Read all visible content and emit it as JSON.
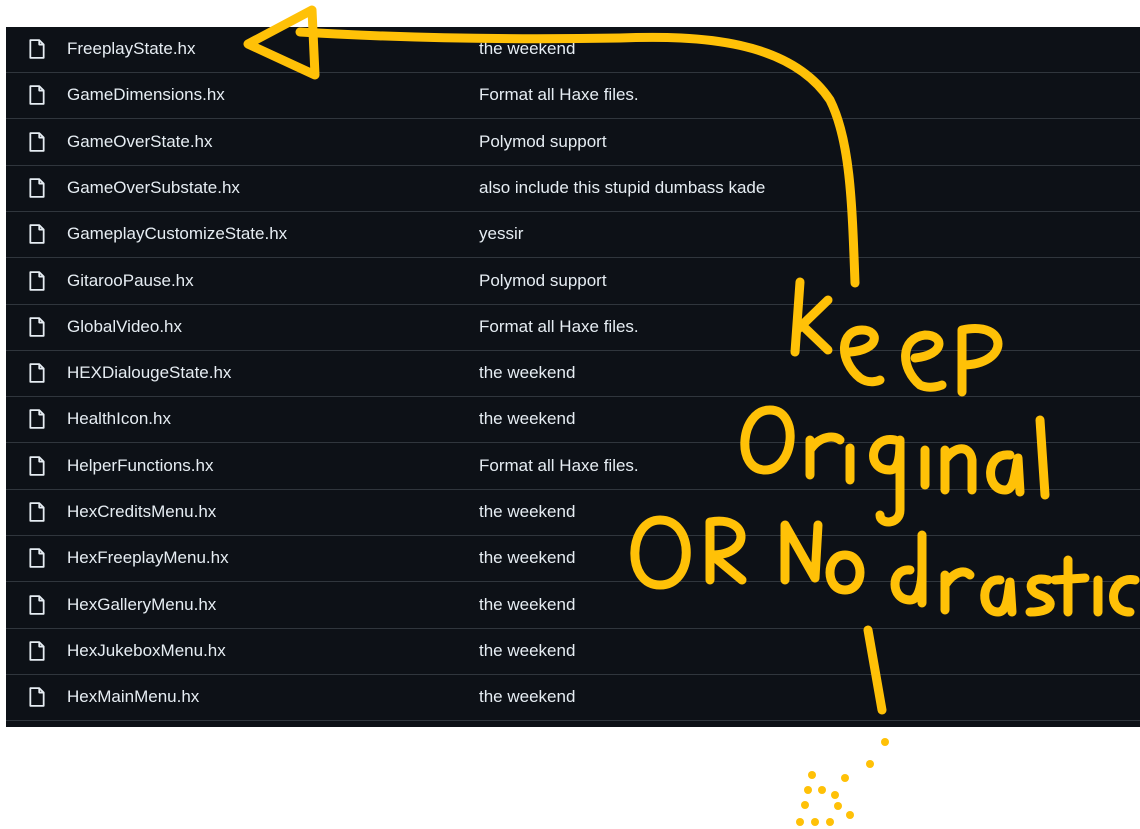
{
  "files": [
    {
      "name": "FreeplayState.hx",
      "message": "the weekend"
    },
    {
      "name": "GameDimensions.hx",
      "message": "Format all Haxe files."
    },
    {
      "name": "GameOverState.hx",
      "message": "Polymod support"
    },
    {
      "name": "GameOverSubstate.hx",
      "message": "also include this stupid dumbass kade"
    },
    {
      "name": "GameplayCustomizeState.hx",
      "message": "yessir"
    },
    {
      "name": "GitarooPause.hx",
      "message": "Polymod support"
    },
    {
      "name": "GlobalVideo.hx",
      "message": "Format all Haxe files."
    },
    {
      "name": "HEXDialougeState.hx",
      "message": "the weekend"
    },
    {
      "name": "HealthIcon.hx",
      "message": "the weekend"
    },
    {
      "name": "HelperFunctions.hx",
      "message": "Format all Haxe files."
    },
    {
      "name": "HexCreditsMenu.hx",
      "message": "the weekend"
    },
    {
      "name": "HexFreeplayMenu.hx",
      "message": "the weekend"
    },
    {
      "name": "HexGalleryMenu.hx",
      "message": "the weekend"
    },
    {
      "name": "HexJukeboxMenu.hx",
      "message": "the weekend"
    },
    {
      "name": "HexMainMenu.hx",
      "message": "the weekend"
    }
  ],
  "annotation": {
    "line1": "keep",
    "line2": "Original",
    "line3": "OR No drastic",
    "color": "#ffc107"
  },
  "theme": {
    "background": "#0d1117",
    "text": "#e6edf3",
    "border": "#30363d",
    "icon": "#e6edf3"
  }
}
